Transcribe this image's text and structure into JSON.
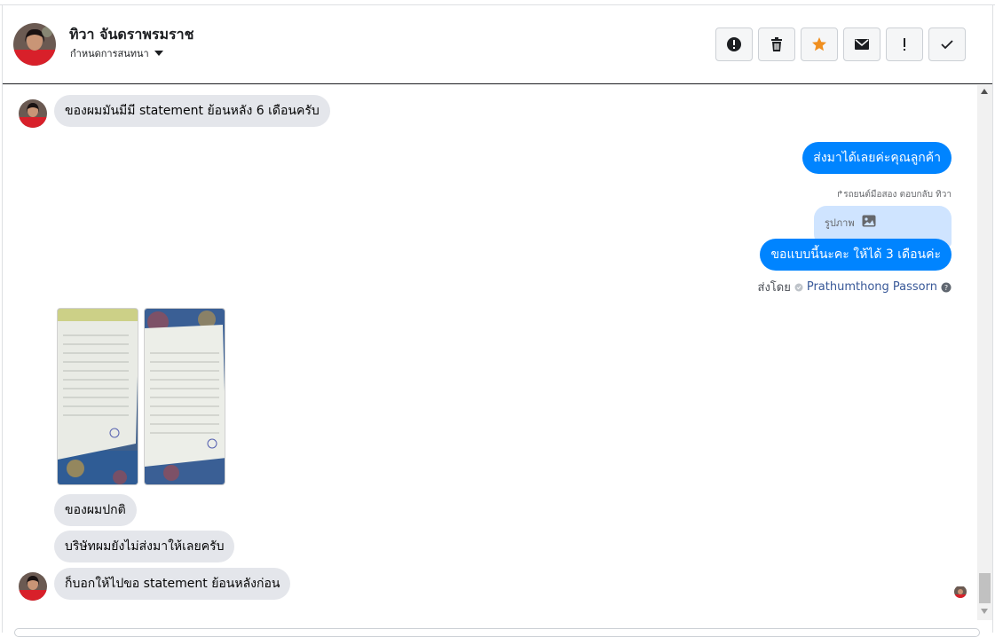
{
  "header": {
    "contact_name": "ทิวา จันดราพรมราช",
    "subtitle": "กำหนดการสนทนา",
    "actions": [
      {
        "icon": "alert-circle-icon",
        "name": "mark-spam-button"
      },
      {
        "icon": "trash-icon",
        "name": "delete-button"
      },
      {
        "icon": "star-icon",
        "name": "star-button"
      },
      {
        "icon": "envelope-icon",
        "name": "mark-unread-button"
      },
      {
        "icon": "exclamation-icon",
        "name": "follow-up-button"
      },
      {
        "icon": "checkmark-icon",
        "name": "mark-done-button"
      }
    ]
  },
  "colors": {
    "incoming_bubble": "#e4e6eb",
    "outgoing_bubble": "#0084ff",
    "star": "#f08f1f",
    "reply_quote": "#cfe4ff"
  },
  "messages": {
    "m1": "ของผมมันมีมี statement ย้อนหลัง 6 เดือนครับ",
    "m2": "ส่งมาได้เลยค่ะคุณลูกค้า",
    "reply_note": "รถยนต์มือสอง ตอบกลับ ทิวา",
    "reply_quote_text": "รูปภาพ",
    "m3": "ขอแบบนี้นะคะ ให้ได้ 3 เดือนค่ะ",
    "sent_by_label": "ส่งโดย",
    "sent_by_name": "Prathumthong Passorn",
    "m4": "ของผมปกติ",
    "m5": "บริษัทผมยังไม่ส่งมาให้เลยครับ",
    "m6": "ก็บอกให้ไปขอ statement ย้อนหลังก่อน"
  }
}
